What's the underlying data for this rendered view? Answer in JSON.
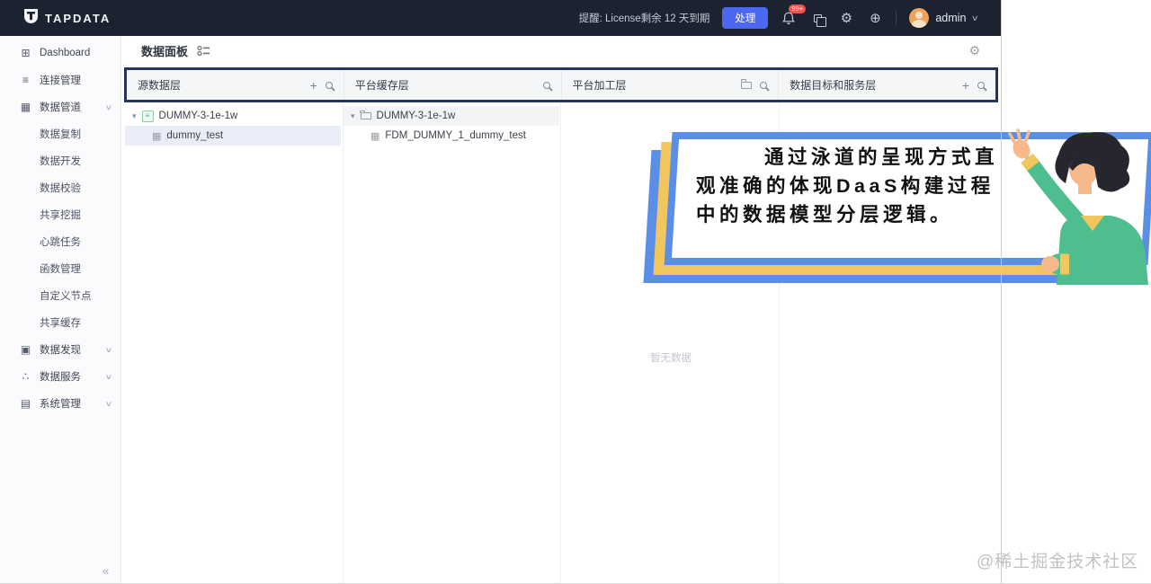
{
  "topbar": {
    "logo_text": "TAPDATA",
    "license_text": "提醒: License剩余 12 天到期",
    "action_button_label": "处理",
    "notification_badge": "99+",
    "username": "admin"
  },
  "page": {
    "title": "数据面板"
  },
  "sidebar": {
    "items": [
      {
        "label": "Dashboard"
      },
      {
        "label": "连接管理"
      },
      {
        "label": "数据管道",
        "children": [
          "数据复制",
          "数据开发",
          "数据校验",
          "共享挖掘",
          "心跳任务",
          "函数管理",
          "自定义节点",
          "共享缓存"
        ]
      },
      {
        "label": "数据发现"
      },
      {
        "label": "数据服务"
      },
      {
        "label": "系统管理"
      }
    ]
  },
  "lanes": [
    {
      "title": "源数据层",
      "tree": [
        {
          "label": "DUMMY-3-1e-1w",
          "children": [
            "dummy_test"
          ]
        }
      ]
    },
    {
      "title": "平台缓存层",
      "tree": [
        {
          "label": "DUMMY-3-1e-1w",
          "children": [
            "FDM_DUMMY_1_dummy_test"
          ]
        }
      ]
    },
    {
      "title": "平台加工层",
      "empty_text": "暂无数据"
    },
    {
      "title": "数据目标和服务层"
    }
  ],
  "callout": {
    "text": "通过泳道的呈现方式直观准确的体现DaaS构建过程中的数据模型分层逻辑。"
  },
  "watermark": "@稀土掘金技术社区",
  "icons": {
    "dashboard": "⊞",
    "connections": "≡",
    "pipeline": "▦",
    "discovery": "▣",
    "services": "∴",
    "system": "▤",
    "caret_down": "▾",
    "chevron_down": "∨",
    "collapse_left": "«",
    "gear": "⚙",
    "globe": "⊕",
    "plus": "+",
    "table": "▦",
    "source_box": "≡"
  },
  "colors": {
    "topbar_bg": "#1b2230",
    "accent_blue": "#4d68f0",
    "navy_highlight": "#24355f",
    "callout_blue": "#5b8ee6",
    "callout_yellow": "#f1c75d",
    "badge_red": "#ef5350",
    "avatar_orange": "#efa35c",
    "row_highlight": "#e8edf8"
  }
}
